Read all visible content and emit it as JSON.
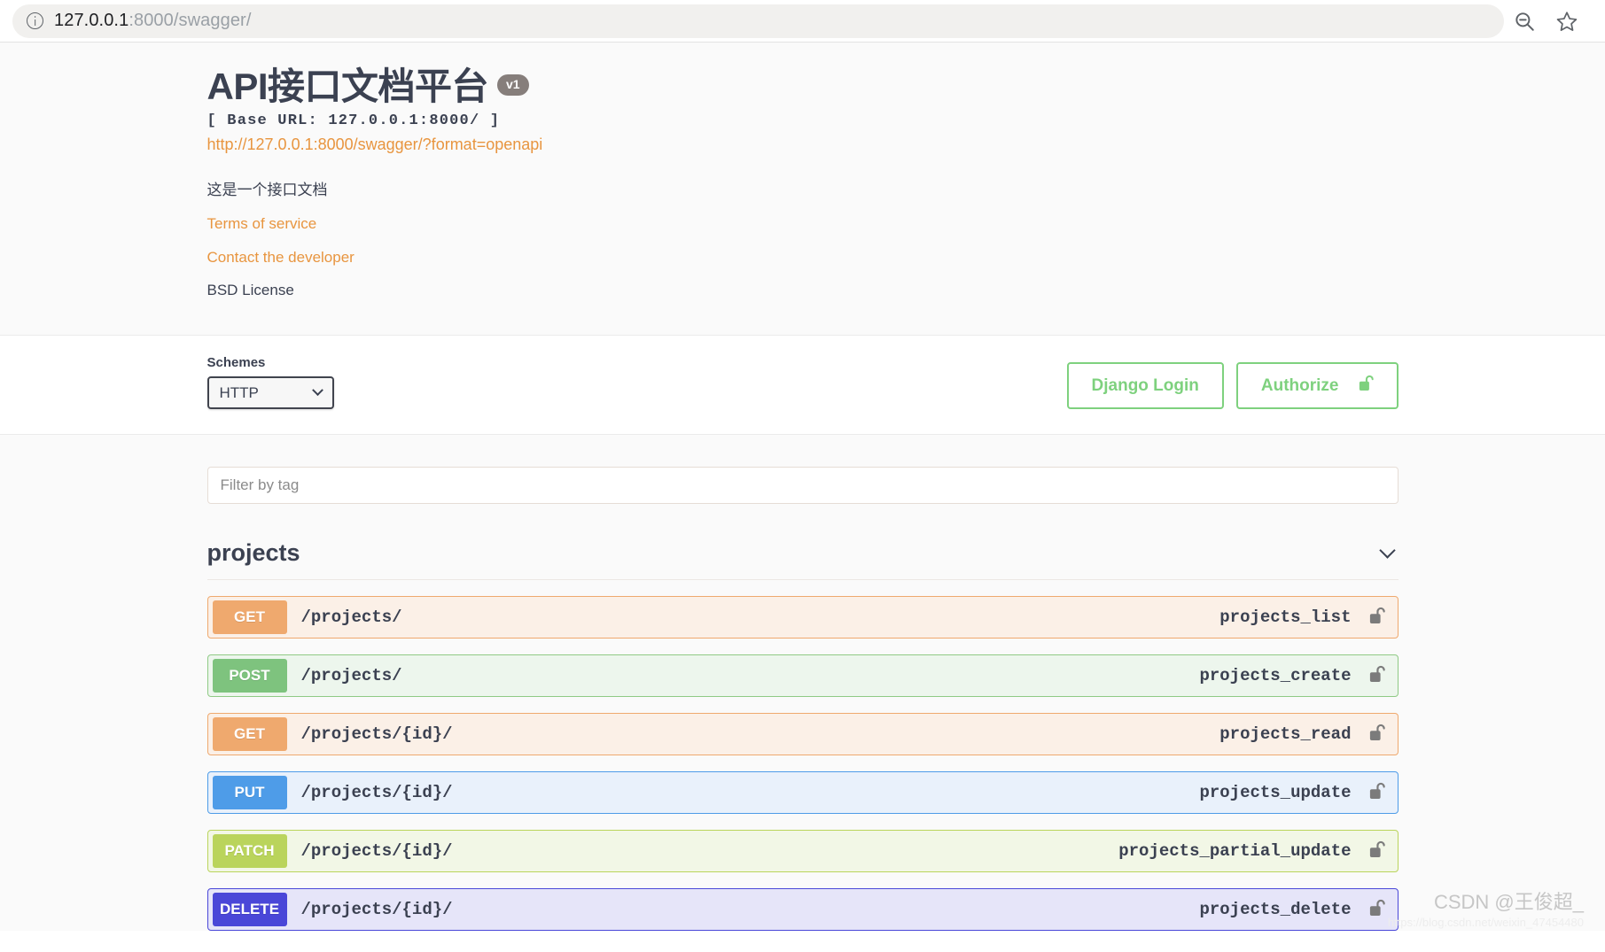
{
  "browser": {
    "url_host": "127.0.0.1",
    "url_rest": ":8000/swagger/",
    "info_icon": "info-icon",
    "zoom_out_icon": "zoom-out-icon",
    "bookmark_icon": "star-icon"
  },
  "info": {
    "title": "API接口文档平台",
    "version": "v1",
    "base_url": "[ Base URL: 127.0.0.1:8000/ ]",
    "spec_link": "http://127.0.0.1:8000/swagger/?format=openapi",
    "description": "这是一个接口文档",
    "terms_label": "Terms of service",
    "contact_label": "Contact the developer",
    "license": "BSD License"
  },
  "schemes": {
    "label": "Schemes",
    "selected": "HTTP",
    "options": [
      "HTTP"
    ]
  },
  "auth": {
    "django_login_label": "Django Login",
    "authorize_label": "Authorize",
    "lock_icon": "unlock-icon",
    "accent_color": "#7ed17e"
  },
  "filter": {
    "placeholder": "Filter by tag",
    "value": ""
  },
  "tag_section": {
    "name": "projects",
    "chevron_icon": "chevron-down-icon"
  },
  "operations": [
    {
      "method": "GET",
      "path": "/projects/",
      "operation_id": "projects_list",
      "badge_color": "#efa96e",
      "row_bg": "#fbf0e7",
      "row_border": "#efa96e",
      "lock_icon": "unlock-icon"
    },
    {
      "method": "POST",
      "path": "/projects/",
      "operation_id": "projects_create",
      "badge_color": "#7ec37e",
      "row_bg": "#edf6ed",
      "row_border": "#8fca85",
      "lock_icon": "unlock-icon"
    },
    {
      "method": "GET",
      "path": "/projects/{id}/",
      "operation_id": "projects_read",
      "badge_color": "#efa96e",
      "row_bg": "#fbf0e7",
      "row_border": "#efa96e",
      "lock_icon": "unlock-icon"
    },
    {
      "method": "PUT",
      "path": "/projects/{id}/",
      "operation_id": "projects_update",
      "badge_color": "#4e9ce8",
      "row_bg": "#e9f1fb",
      "row_border": "#4e9ce8",
      "lock_icon": "unlock-icon"
    },
    {
      "method": "PATCH",
      "path": "/projects/{id}/",
      "operation_id": "projects_partial_update",
      "badge_color": "#bad45c",
      "row_bg": "#f2f7e6",
      "row_border": "#bad45c",
      "lock_icon": "unlock-icon"
    },
    {
      "method": "DELETE",
      "path": "/projects/{id}/",
      "operation_id": "projects_delete",
      "badge_color": "#4a47d8",
      "row_bg": "#e6e5f9",
      "row_border": "#4a47d8",
      "lock_icon": "unlock-icon"
    }
  ],
  "watermark": {
    "main": "CSDN @王俊超_",
    "sub": "https://blog.csdn.net/weixin_47454480"
  }
}
